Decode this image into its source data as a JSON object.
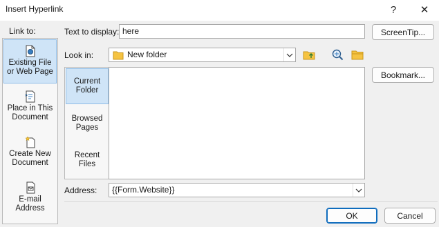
{
  "window": {
    "title": "Insert Hyperlink",
    "help_glyph": "?",
    "close_glyph": "✕"
  },
  "link_to": {
    "label": "Link to:",
    "items": [
      {
        "line1": "Existing File",
        "line2": "or Web Page",
        "icon": "existing-file-icon",
        "selected": true
      },
      {
        "line1": "Place in This",
        "line2": "Document",
        "icon": "place-in-document-icon",
        "selected": false
      },
      {
        "line1": "Create New",
        "line2": "Document",
        "icon": "new-document-icon",
        "selected": false
      },
      {
        "line1": "E-mail",
        "line2": "Address",
        "icon": "email-address-icon",
        "selected": false
      }
    ]
  },
  "text_to_display": {
    "label": "Text to display:",
    "value": "here"
  },
  "screen_tip_button": "ScreenTip...",
  "look_in": {
    "label": "Look in:",
    "value": "New folder",
    "folder_icon": "folder-icon",
    "up_folder_icon": "up-folder-icon",
    "browse_web_icon": "browse-web-icon",
    "browse_file_icon": "browse-file-icon"
  },
  "bookmark_button": "Bookmark...",
  "sub_tabs": [
    {
      "line1": "Current",
      "line2": "Folder",
      "selected": true
    },
    {
      "line1": "Browsed",
      "line2": "Pages",
      "selected": false
    },
    {
      "line1": "Recent",
      "line2": "Files",
      "selected": false
    }
  ],
  "address": {
    "label": "Address:",
    "value": "{{Form.Website}}"
  },
  "buttons": {
    "ok": "OK",
    "cancel": "Cancel"
  },
  "colors": {
    "selection_bg": "#cfe4f7",
    "selection_border": "#8fbde8",
    "primary_border": "#0f6cbd",
    "folder_yellow": "#f5c342"
  }
}
